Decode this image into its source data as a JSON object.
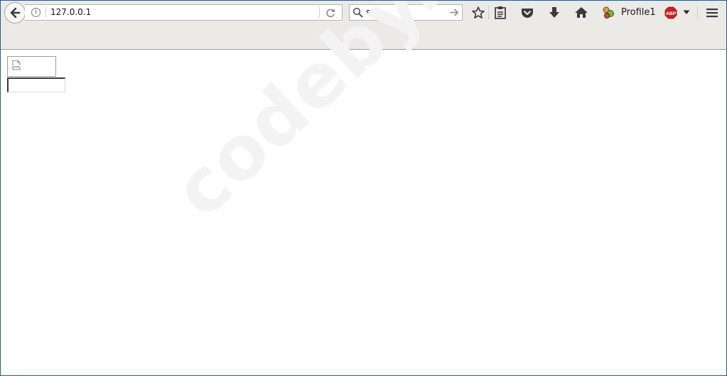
{
  "browser": {
    "url": "127.0.0.1",
    "search_query": "sc",
    "profile_name": "Profile1",
    "adblock_badge": "ABP"
  },
  "page": {
    "watermark": "codeby.net",
    "image_alt": "",
    "text_input_value": ""
  },
  "icons": {
    "back": "back-arrow-icon",
    "info": "info-icon",
    "reload": "reload-icon",
    "search": "search-icon",
    "go": "go-arrow-icon",
    "bookmark": "star-icon",
    "reading_list": "clipboard-icon",
    "pocket": "pocket-icon",
    "downloads": "download-arrow-icon",
    "home": "home-icon",
    "profile": "profile-switcher-icon",
    "adblock": "adblock-plus-icon",
    "dropdown": "caret-down-icon",
    "menu": "hamburger-menu-icon"
  },
  "colors": {
    "toolbar_bg": "#ebeae6",
    "abp_red": "#cc1f1f",
    "window_border": "#2a5a8a"
  }
}
